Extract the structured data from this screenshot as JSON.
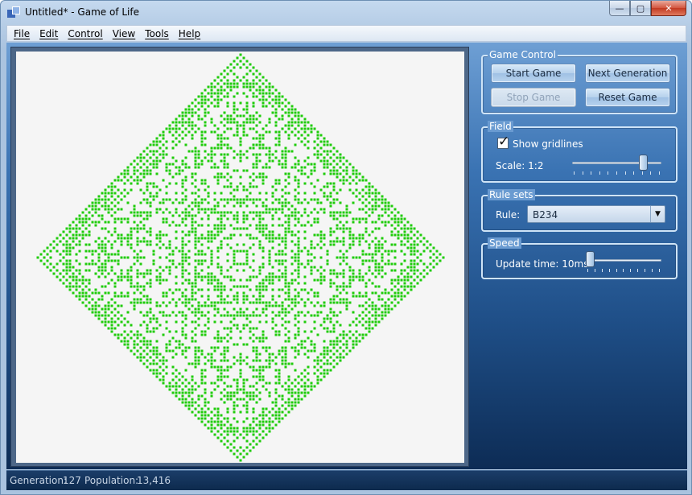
{
  "window": {
    "title": "Untitled* - Game of Life",
    "minimize_glyph": "—",
    "maximize_glyph": "▢",
    "close_glyph": "✕"
  },
  "menu": [
    "File",
    "Edit",
    "Control",
    "View",
    "Tools",
    "Help"
  ],
  "game_control": {
    "title": "Game Control",
    "start_label": "Start Game",
    "next_label": "Next Generation",
    "stop_label": "Stop Game",
    "reset_label": "Reset Game"
  },
  "field": {
    "title": "Field",
    "show_gridlines_label": "Show gridlines",
    "show_gridlines_checked": true,
    "checkmark": "✓",
    "scale_label": "Scale: 1:2",
    "scale_level": 0.83
  },
  "rule_sets": {
    "title": "Rule sets",
    "rule_label": "Rule:",
    "rule_value": "B234",
    "arrow": "▼"
  },
  "speed": {
    "title": "Speed",
    "update_label": "Update time: 10ms",
    "speed_level": 0
  },
  "status": {
    "generation_label": "Generation:",
    "generation_value": "127",
    "population_label": "Population:",
    "population_value": "13,416"
  },
  "colors": {
    "live_cell": "#1fcc0a",
    "field_background": "#f5f5f5"
  }
}
